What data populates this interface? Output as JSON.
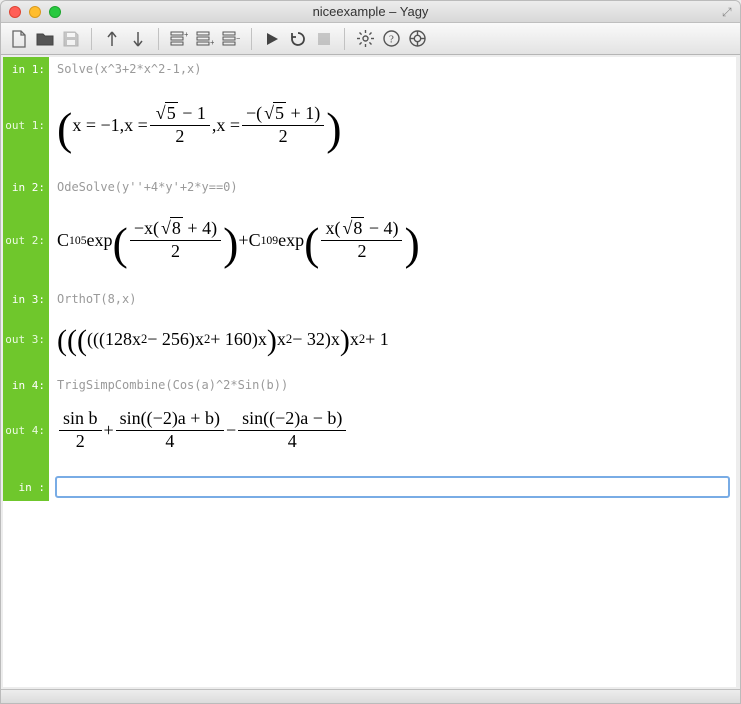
{
  "window": {
    "title": "niceexample – Yagy"
  },
  "toolbar": {
    "new": "new",
    "open": "open",
    "save": "save",
    "up": "up",
    "down": "down",
    "ins_above": "insert-above",
    "ins_below": "insert-below",
    "del": "delete-cell",
    "run": "run",
    "rerun": "rerun",
    "stop": "stop",
    "settings": "settings",
    "help": "help",
    "community": "community"
  },
  "cells": [
    {
      "in_label": "in  1:",
      "in_code": "Solve(x^3+2*x^2-1,x)",
      "out_label": "out 1:"
    },
    {
      "in_label": "in  2:",
      "in_code": "OdeSolve(y''+4*y'+2*y==0)",
      "out_label": "out 2:"
    },
    {
      "in_label": "in  3:",
      "in_code": "OrthoT(8,x)",
      "out_label": "out 3:"
    },
    {
      "in_label": "in  4:",
      "in_code": "TrigSimpCombine(Cos(a)^2*Sin(b))",
      "out_label": "out 4:"
    },
    {
      "in_label": "in   :"
    }
  ],
  "math": {
    "m1": {
      "x_eq_neg1": "x = −1",
      "x_eq": ",x = ",
      "sqrt5_minus1": "5",
      "minus1": " − 1",
      "two": "2",
      "x_eq2": " ,x = ",
      "neg_open": "−(",
      "plus1_close": " + 1)"
    },
    "m2": {
      "C105": "C",
      "s105": "105",
      "exp": " exp",
      "negx": "−x(",
      "sqrt8": "8",
      "plus4": " + 4)",
      "two": "2",
      "plus": " + ",
      "C109": "C",
      "s109": "109",
      "x": "x(",
      "minus4": " − 4)"
    },
    "m3": {
      "expr": "(((128x",
      "sq": "2",
      "m256": " − 256)x",
      "p160": " + 160)x",
      "m32": " − 32)x",
      "p1": " + 1"
    },
    "m4": {
      "sinb": "sin b",
      "two": "2",
      "plus": " + ",
      "sin_neg2a_pb": "sin((−2)a + b)",
      "four": "4",
      "minus": " − ",
      "sin_neg2a_mb": "sin((−2)a − b)"
    }
  }
}
